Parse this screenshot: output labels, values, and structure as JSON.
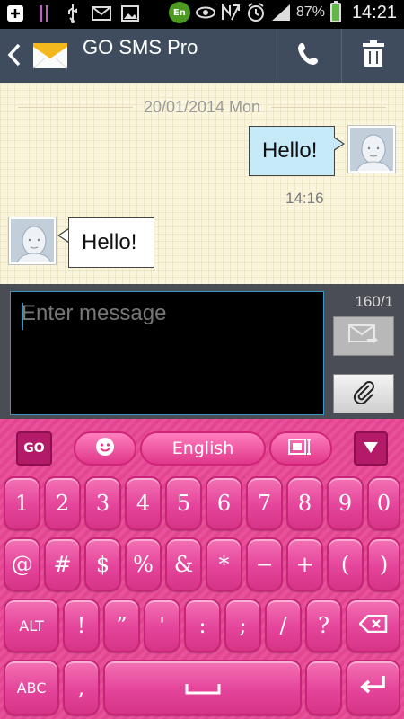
{
  "status_bar": {
    "battery": "87%",
    "clock": "14:21",
    "input_badge": "En",
    "icons": [
      "add-box-icon",
      "bars-icon",
      "usb-icon",
      "mail-icon",
      "image-icon",
      "eye-icon",
      "nfc-icon",
      "alarm-icon",
      "signal-icon",
      "battery-icon"
    ]
  },
  "app_bar": {
    "title": "GO SMS Pro",
    "colors": {
      "bar": "#3f4c5e"
    }
  },
  "conversation": {
    "date": "20/01/2014 Mon",
    "messages": [
      {
        "direction": "outgoing",
        "text": "Hello!",
        "time": "14:16"
      },
      {
        "direction": "incoming",
        "text": "Hello!"
      }
    ]
  },
  "compose": {
    "placeholder": "Enter message",
    "counter": "160/1"
  },
  "keyboard": {
    "go_label": "GO",
    "language": "English",
    "row1": [
      "1",
      "2",
      "3",
      "4",
      "5",
      "6",
      "7",
      "8",
      "9",
      "0"
    ],
    "row2": [
      "@",
      "#",
      "$",
      "%",
      "&",
      "*",
      "−",
      "+",
      "(",
      ")"
    ],
    "row3": [
      "ALT",
      "!",
      "”",
      "'",
      ":",
      ";",
      "/",
      "?"
    ],
    "row4_left": [
      "ABC",
      ","
    ],
    "accent": "#e8519b"
  }
}
